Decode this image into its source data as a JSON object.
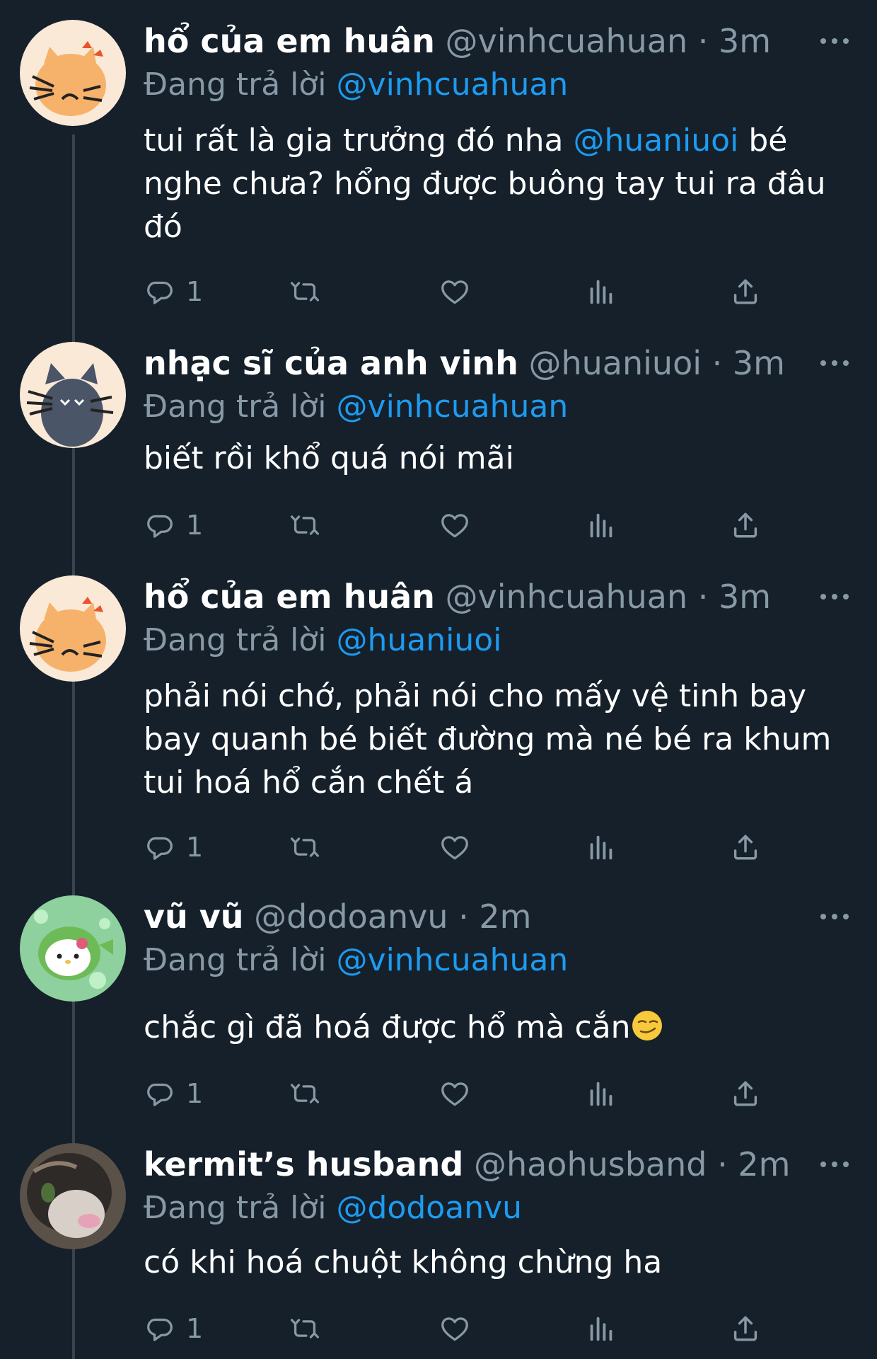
{
  "colors": {
    "background": "#15202b",
    "text": "#ffffff",
    "secondary_text": "#8899a6",
    "accent": "#1d9bf0",
    "thread_line": "#38444d"
  },
  "icons": {
    "reply": "reply-icon",
    "retweet": "retweet-icon",
    "like": "heart-icon",
    "views": "views-icon",
    "share": "share-icon",
    "more": "more-icon"
  },
  "tweets": [
    {
      "display_name": "hổ của em huân",
      "handle": "@vinhcuahuan",
      "separator": "·",
      "time": "3m",
      "replying_prefix": "Đang trả lời",
      "replying_to": "@vinhcuahuan",
      "text_parts": {
        "a": "tui rất là gia trưởng đó nha ",
        "mention": "@huaniuoi",
        "b": " bé nghe chưa? hổng được buông tay tui ra đâu đó"
      },
      "reply_count": "1"
    },
    {
      "display_name": "nhạc sĩ của anh vinh",
      "handle": "@huaniuoi",
      "separator": "·",
      "time": "3m",
      "replying_prefix": "Đang trả lời",
      "replying_to": "@vinhcuahuan",
      "text": "biết rồi khổ quá nói mãi",
      "reply_count": "1"
    },
    {
      "display_name": "hổ của em huân",
      "handle": "@vinhcuahuan",
      "separator": "·",
      "time": "3m",
      "replying_prefix": "Đang trả lời",
      "replying_to": "@huaniuoi",
      "text": "phải nói chớ, phải nói cho mấy vệ tinh bay bay quanh bé biết đường mà né bé ra khum tui hoá hổ cắn chết á",
      "reply_count": "1"
    },
    {
      "display_name": "vũ vũ",
      "handle": "@dodoanvu",
      "separator": "·",
      "time": "2m",
      "replying_prefix": "Đang trả lời",
      "replying_to": "@vinhcuahuan",
      "text": "chắc gì đã hoá được hổ mà cắn",
      "emoji": "smirking-face",
      "reply_count": "1"
    },
    {
      "display_name": "kermit’s husband",
      "handle": "@haohusband",
      "separator": "·",
      "time": "2m",
      "replying_prefix": "Đang trả lời",
      "replying_to": "@dodoanvu",
      "text": "có khi hoá chuột không chừng ha",
      "reply_count": "1"
    }
  ]
}
